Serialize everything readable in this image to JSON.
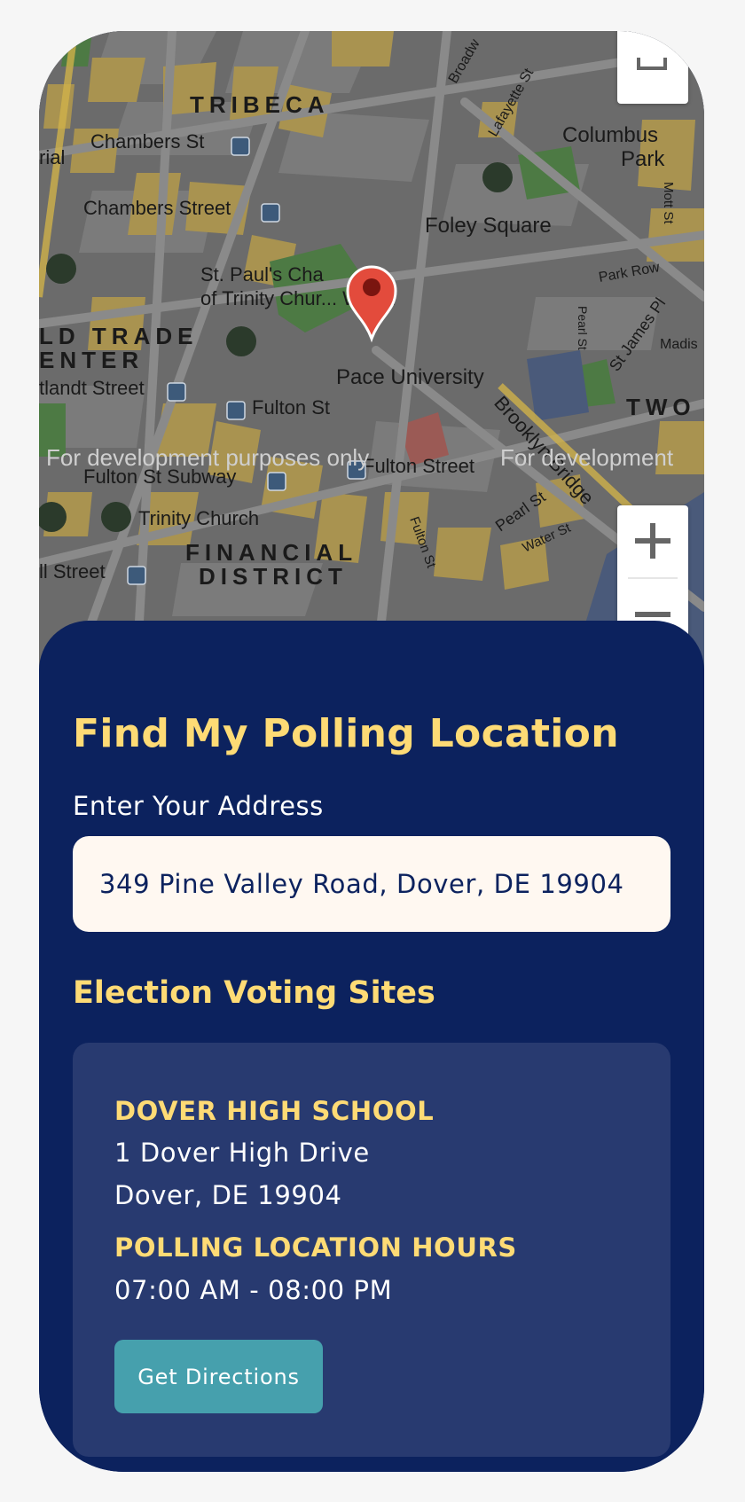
{
  "map": {
    "labels": {
      "tribeca": "TRIBECA",
      "chambers_st": "Chambers St",
      "chambers_street": "Chambers Street",
      "st_pauls_1": "St. Paul's Cha",
      "st_pauls_2": "of Trinity Chur... Wall...",
      "world_trade_1": "LD TRADE",
      "world_trade_2": "ENTER",
      "cortlandt": "tlandt Street",
      "fulton_st": "Fulton St",
      "fulton_st_subway": "Fulton St Subway",
      "fulton_street": "Fulton Street",
      "trinity_church": "Trinity Church",
      "financial_1": "FINANCIAL",
      "financial_2": "DISTRICT",
      "wall_street": "ll Street",
      "pace": "Pace University",
      "foley": "Foley Square",
      "columbus_1": "Columbus",
      "columbus_2": "Park",
      "two": "TWO",
      "brooklyn_bridge": "Brooklyn Bridge",
      "pearl_st": "Pearl St",
      "pearl_st2": "Pearl St",
      "water_st": "Water St",
      "fulton_st_street": "Fulton St",
      "park_row": "Park Row",
      "st_james": "St James Pl",
      "madison": "Madis",
      "mott_st": "Mott St",
      "lafayette": "Lafayette St",
      "broadway": "Broadw",
      "rial": "rial",
      "dev_1": "For development purposes only",
      "dev_2": "For development"
    }
  },
  "finder": {
    "title": "Find My Polling Location",
    "address_label": "Enter Your Address",
    "address_value": "349 Pine Valley Road, Dover, DE 19904",
    "sites_heading": "Election Voting Sites"
  },
  "site": {
    "name": "DOVER HIGH SCHOOL",
    "address_line1": "1 Dover High Drive",
    "address_line2": "Dover, DE 19904",
    "hours_label": "POLLING LOCATION HOURS",
    "hours": "07:00 AM - 08:00 PM",
    "directions_label": "Get Directions"
  },
  "colors": {
    "navy": "#0c225e",
    "card": "#283a70",
    "accent_yellow": "#fedb75",
    "button_teal": "#46a0ad",
    "input_bg": "#fff8f1",
    "pin_red": "#e34b3c"
  }
}
